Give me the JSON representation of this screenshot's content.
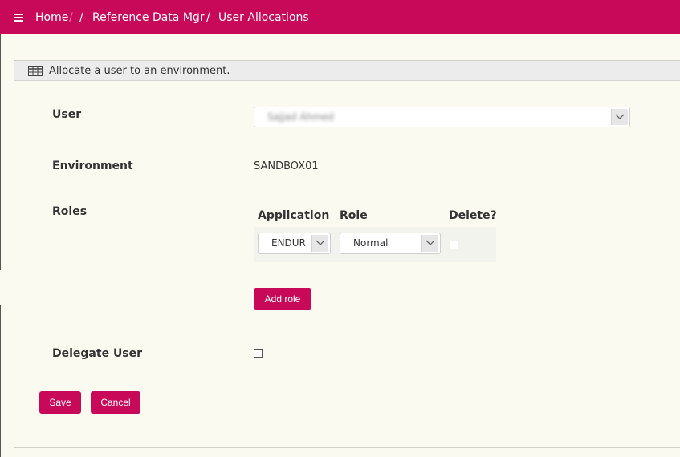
{
  "breadcrumb": {
    "home": "Home",
    "reference": "Reference Data Mgr",
    "current": "User Allocations",
    "separator": "/"
  },
  "panel": {
    "title": "Allocate a user to an environment.",
    "icon": "table-icon"
  },
  "form": {
    "user_label": "User",
    "user_value": "Sajjad Ahmed",
    "environment_label": "Environment",
    "environment_value": "SANDBOX01",
    "roles_label": "Roles",
    "roles_table": {
      "headers": [
        "Application",
        "Role",
        "Delete?"
      ],
      "rows": [
        {
          "application": "ENDUR",
          "role": "Normal",
          "delete": false
        }
      ]
    },
    "add_role_label": "Add role",
    "delegate_label": "Delegate User",
    "delegate_checked": false
  },
  "actions": {
    "save_label": "Save",
    "cancel_label": "Cancel"
  },
  "colors": {
    "brand": "#c8095a",
    "background": "#fbfaf0"
  }
}
